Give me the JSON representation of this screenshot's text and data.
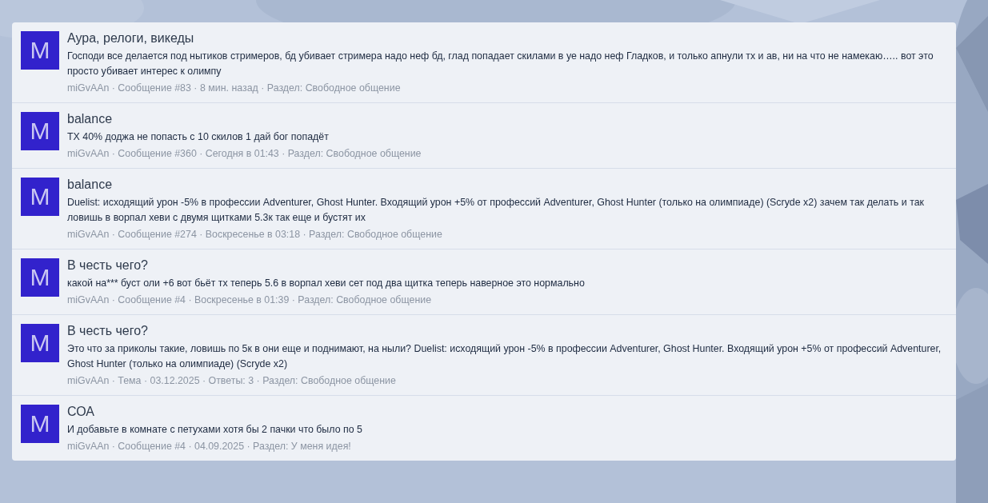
{
  "results": [
    {
      "avatar": "M",
      "title": "Аура, релоги, викеды",
      "snippet": "Господи все делается под нытиков стримеров, бд убивает стримера надо неф бд, глад попадает скилами в уе надо неф Гладков, и только апнули тх и ав, ни на что не намекаю….. вот это просто убивает интерес к олимпу",
      "meta": "miGvAAn · Сообщение #83 · 8 мин. назад · Раздел: Свободное общение"
    },
    {
      "avatar": "M",
      "title": "balance",
      "snippet": "ТХ 40% доджа не попасть с 10 скилов 1 дай бог попадёт",
      "meta": "miGvAAn · Сообщение #360 · Сегодня в 01:43 · Раздел: Свободное общение"
    },
    {
      "avatar": "M",
      "title": "balance",
      "snippet": "Duelist: исходящий урон -5% в профессии Adventurer, Ghost Hunter. Входящий урон +5% от профессий Adventurer, Ghost Hunter (только на олимпиаде) (Scryde x2) зачем так делать и так ловишь в ворпал хеви с двумя щитками 5.3к так еще и бустят их",
      "meta": "miGvAAn · Сообщение #274 · Воскресенье в 03:18 · Раздел: Свободное общение"
    },
    {
      "avatar": "M",
      "title": "В честь чего?",
      "snippet": "какой на*** буст оли +6 вот бьёт тх теперь 5.6 в ворпал хеви сет под два щитка теперь наверное это нормально",
      "meta": "miGvAAn · Сообщение #4 · Воскресенье в 01:39 · Раздел: Свободное общение"
    },
    {
      "avatar": "M",
      "title": "В честь чего?",
      "snippet": "Это что за приколы такие, ловишь по 5к в они еще и поднимают, на ныли? Duelist: исходящий урон -5% в профессии Adventurer, Ghost Hunter. Входящий урон +5% от профессий Adventurer, Ghost Hunter (только на олимпиаде) (Scryde x2)",
      "meta": "miGvAAn · Тема · 03.12.2025 · Ответы: 3 · Раздел: Свободное общение"
    },
    {
      "avatar": "M",
      "title": "СОА",
      "snippet": "И добавьте в комнате с петухами хотя бы 2 пачки что было по 5",
      "meta": "miGvAAn · Сообщение #4 · 04.09.2025 · Раздел: У меня идея!"
    }
  ]
}
